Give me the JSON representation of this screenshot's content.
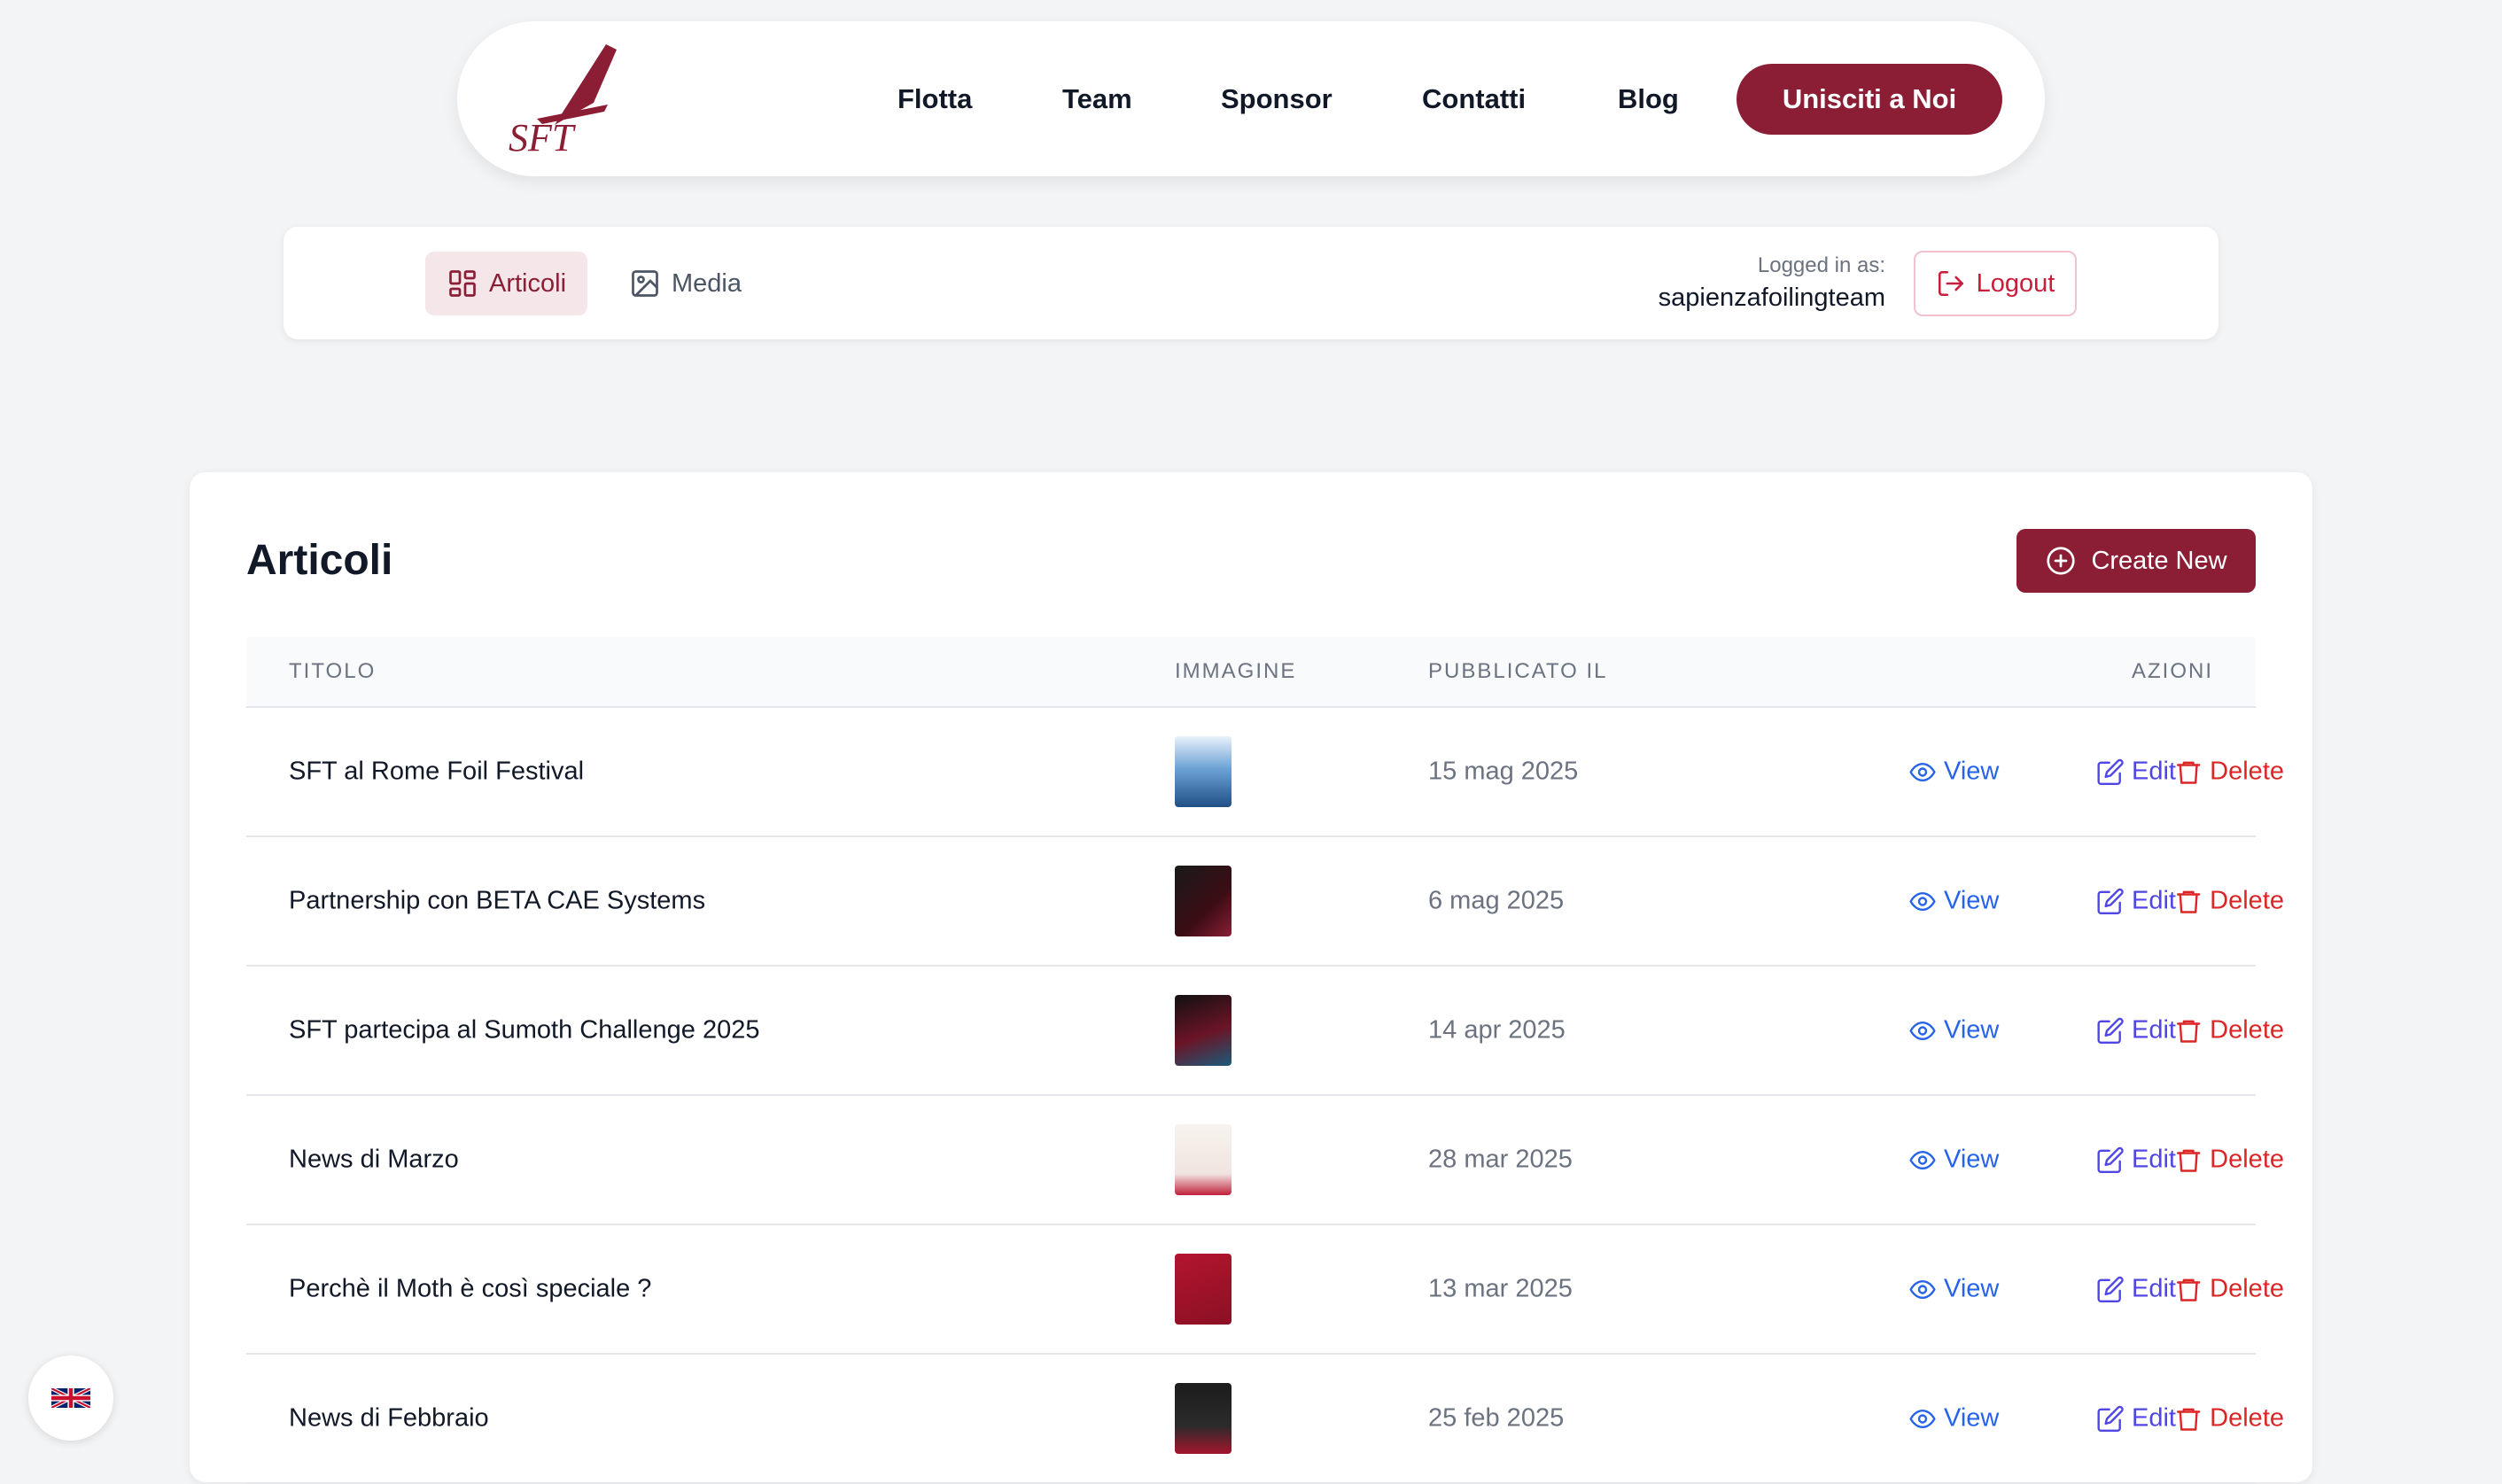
{
  "nav": {
    "logo_text": "SFT",
    "links": [
      "Flotta",
      "Team",
      "Sponsor",
      "Contatti",
      "Blog"
    ],
    "cta": "Unisciti a Noi"
  },
  "admin": {
    "tabs": [
      {
        "label": "Articoli",
        "icon": "grid-icon",
        "active": true
      },
      {
        "label": "Media",
        "icon": "image-icon",
        "active": false
      }
    ],
    "logged_label": "Logged in as:",
    "username": "sapienzafoilingteam",
    "logout": "Logout"
  },
  "main": {
    "title": "Articoli",
    "create_label": "Create New",
    "columns": [
      "TITOLO",
      "IMMAGINE",
      "PUBBLICATO IL",
      "AZIONI"
    ],
    "actions": {
      "view": "View",
      "edit": "Edit",
      "delete": "Delete"
    },
    "rows": [
      {
        "title": "SFT al Rome Foil Festival",
        "date": "15 mag 2025",
        "thumb": "festival-poster"
      },
      {
        "title": "Partnership con BETA CAE Systems",
        "date": "6 mag 2025",
        "thumb": "beta-cae-poster"
      },
      {
        "title": "SFT partecipa al Sumoth Challenge 2025",
        "date": "14 apr 2025",
        "thumb": "sumoth-poster"
      },
      {
        "title": "News di Marzo",
        "date": "28 mar 2025",
        "thumb": "monthly-update-2"
      },
      {
        "title": "Perchè il Moth è così speciale ?",
        "date": "13 mar 2025",
        "thumb": "moth-special-poster"
      },
      {
        "title": "News di Febbraio",
        "date": "25 feb 2025",
        "thumb": "monthly-update-1"
      }
    ]
  },
  "colors": {
    "brand": "#8b1e35",
    "view": "#2563eb",
    "edit": "#4f46e5",
    "delete": "#dc2626"
  },
  "language": {
    "icon": "uk-flag-icon"
  }
}
